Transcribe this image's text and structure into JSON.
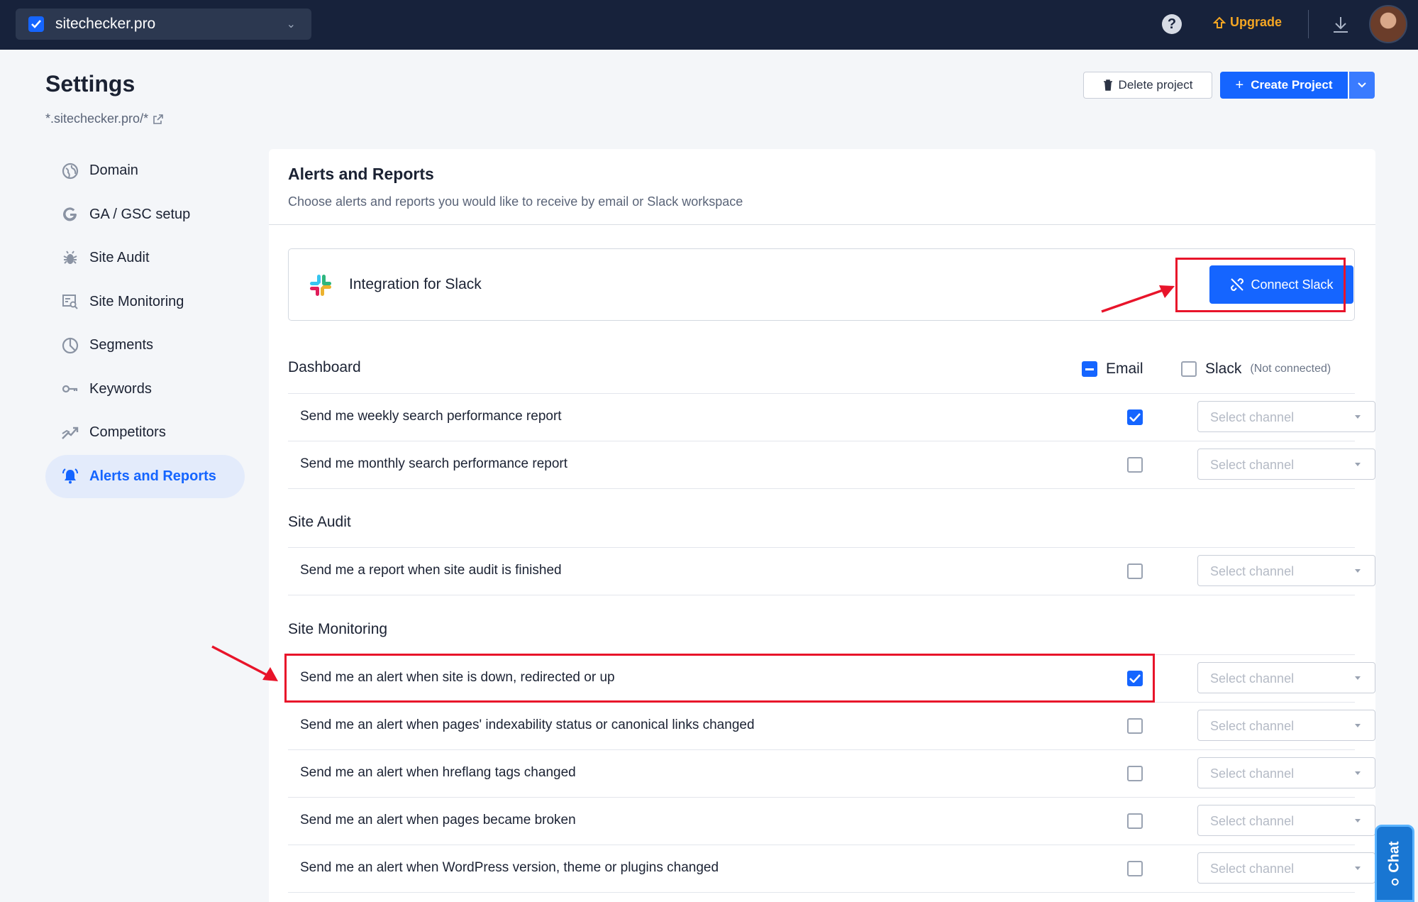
{
  "topbar": {
    "site_name": "sitechecker.pro",
    "upgrade_label": "Upgrade",
    "help_label": "?"
  },
  "header": {
    "title": "Settings",
    "url": "*.sitechecker.pro/*",
    "delete_label": "Delete project",
    "create_label": "Create Project"
  },
  "sidebar": {
    "items": [
      {
        "label": "Domain",
        "icon": "globe-icon"
      },
      {
        "label": "GA / GSC setup",
        "icon": "google-icon"
      },
      {
        "label": "Site Audit",
        "icon": "bug-icon"
      },
      {
        "label": "Site Monitoring",
        "icon": "monitor-icon"
      },
      {
        "label": "Segments",
        "icon": "pie-icon"
      },
      {
        "label": "Keywords",
        "icon": "key-icon"
      },
      {
        "label": "Competitors",
        "icon": "competitors-icon"
      },
      {
        "label": "Alerts and Reports",
        "icon": "bell-icon",
        "active": true
      }
    ]
  },
  "panel": {
    "title": "Alerts and Reports",
    "subtitle": "Choose alerts and reports you would like to receive by email or Slack workspace",
    "slack": {
      "label": "Integration for Slack",
      "connect_label": "Connect Slack"
    },
    "columns": {
      "email": "Email",
      "slack": "Slack",
      "slack_status": "(Not connected)"
    },
    "select_placeholder": "Select channel",
    "sections": [
      {
        "title": "Dashboard",
        "rows": [
          {
            "label": "Send me weekly search performance report",
            "email": true
          },
          {
            "label": "Send me monthly search performance report",
            "email": false
          }
        ]
      },
      {
        "title": "Site Audit",
        "rows": [
          {
            "label": "Send me a report when site audit is finished",
            "email": false
          }
        ]
      },
      {
        "title": "Site Monitoring",
        "rows": [
          {
            "label": "Send me an alert when site is down, redirected or up",
            "email": true
          },
          {
            "label": "Send me an alert when pages' indexability status or canonical links changed",
            "email": false
          },
          {
            "label": "Send me an alert when hreflang tags changed",
            "email": false
          },
          {
            "label": "Send me an alert when pages became broken",
            "email": false
          },
          {
            "label": "Send me an alert when WordPress version, theme or plugins changed",
            "email": false
          }
        ]
      }
    ]
  },
  "chat": {
    "label": "Chat"
  },
  "colors": {
    "accent": "#1565ff",
    "topbar": "#17223b",
    "highlight": "#e8142a",
    "upgrade": "#f5a623"
  }
}
